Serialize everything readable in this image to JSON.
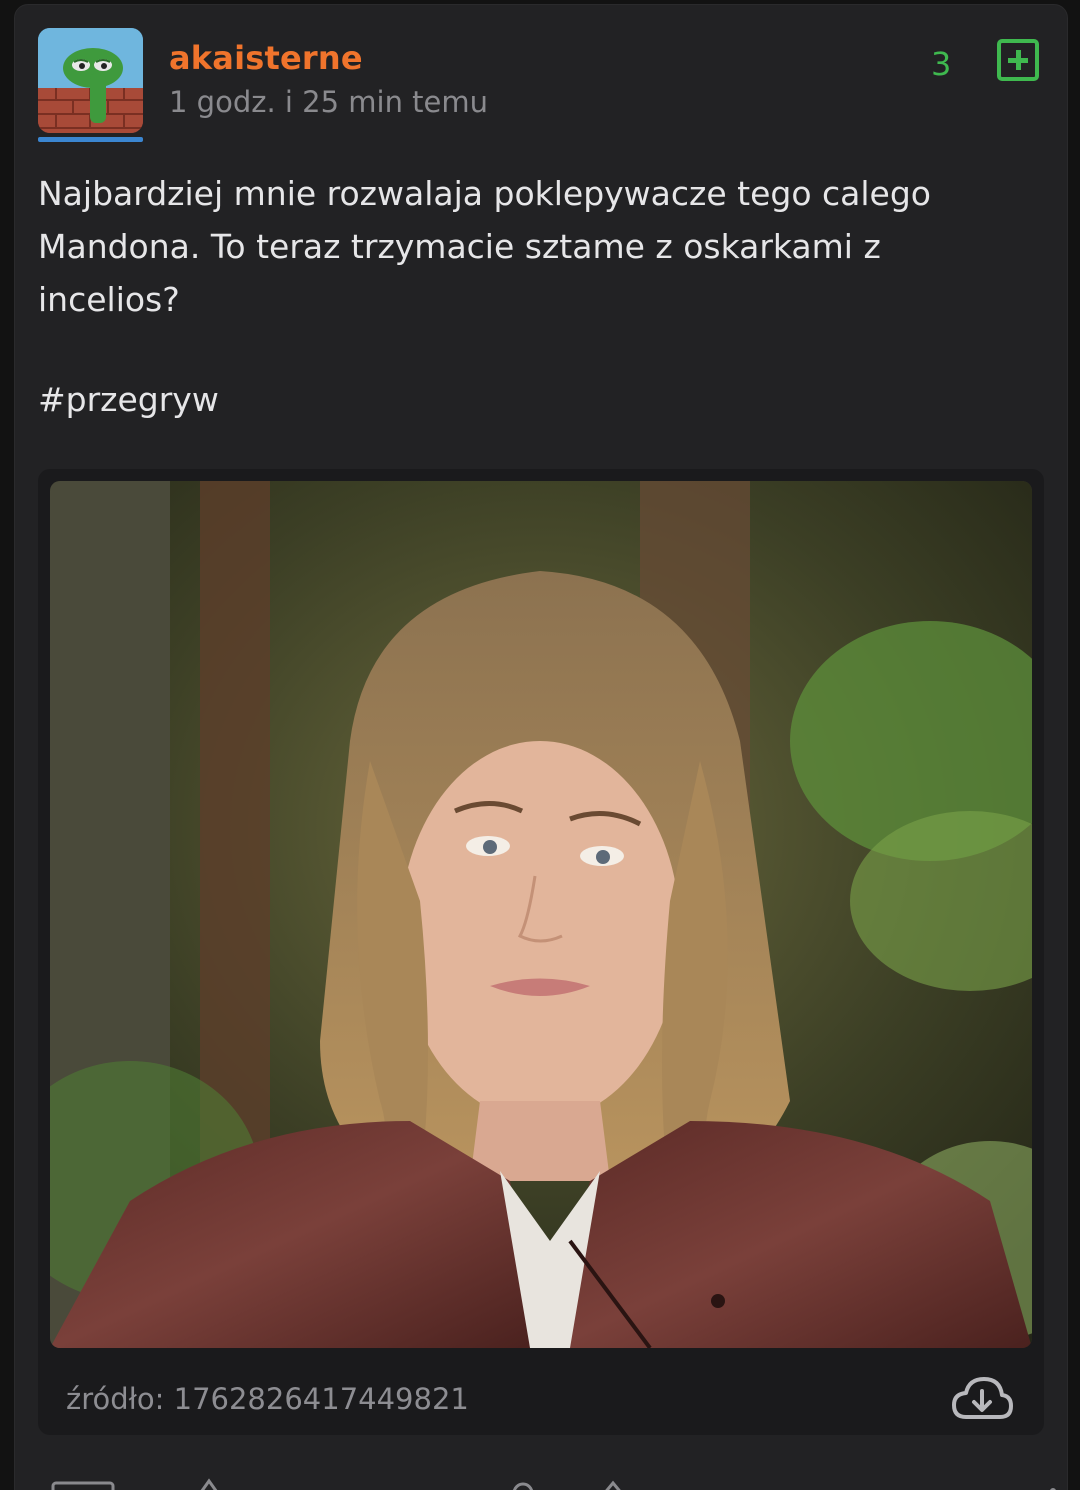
{
  "post": {
    "author": "akaisterne",
    "time_ago": "1 godz. i 25 min temu",
    "votes": "3",
    "plus_icon": "plus-square-icon",
    "text": "Najbardziej mnie rozwalaja poklepywacze tego calego\nMandona. To teraz trzymacie sztame z oskarkami z\nincelios?",
    "hashtag": "#przegryw",
    "avatar_icon": "frog-avatar",
    "colors": {
      "author": "#f0742c",
      "votes": "#3fb94f",
      "card_bg": "#222224",
      "text": "#e6e6e8",
      "meta": "#8a8a8e"
    }
  },
  "embed": {
    "image_icon": "portrait-photo",
    "source_label": "źródło: 1762826417449821",
    "download_icon": "cloud-download-icon"
  }
}
